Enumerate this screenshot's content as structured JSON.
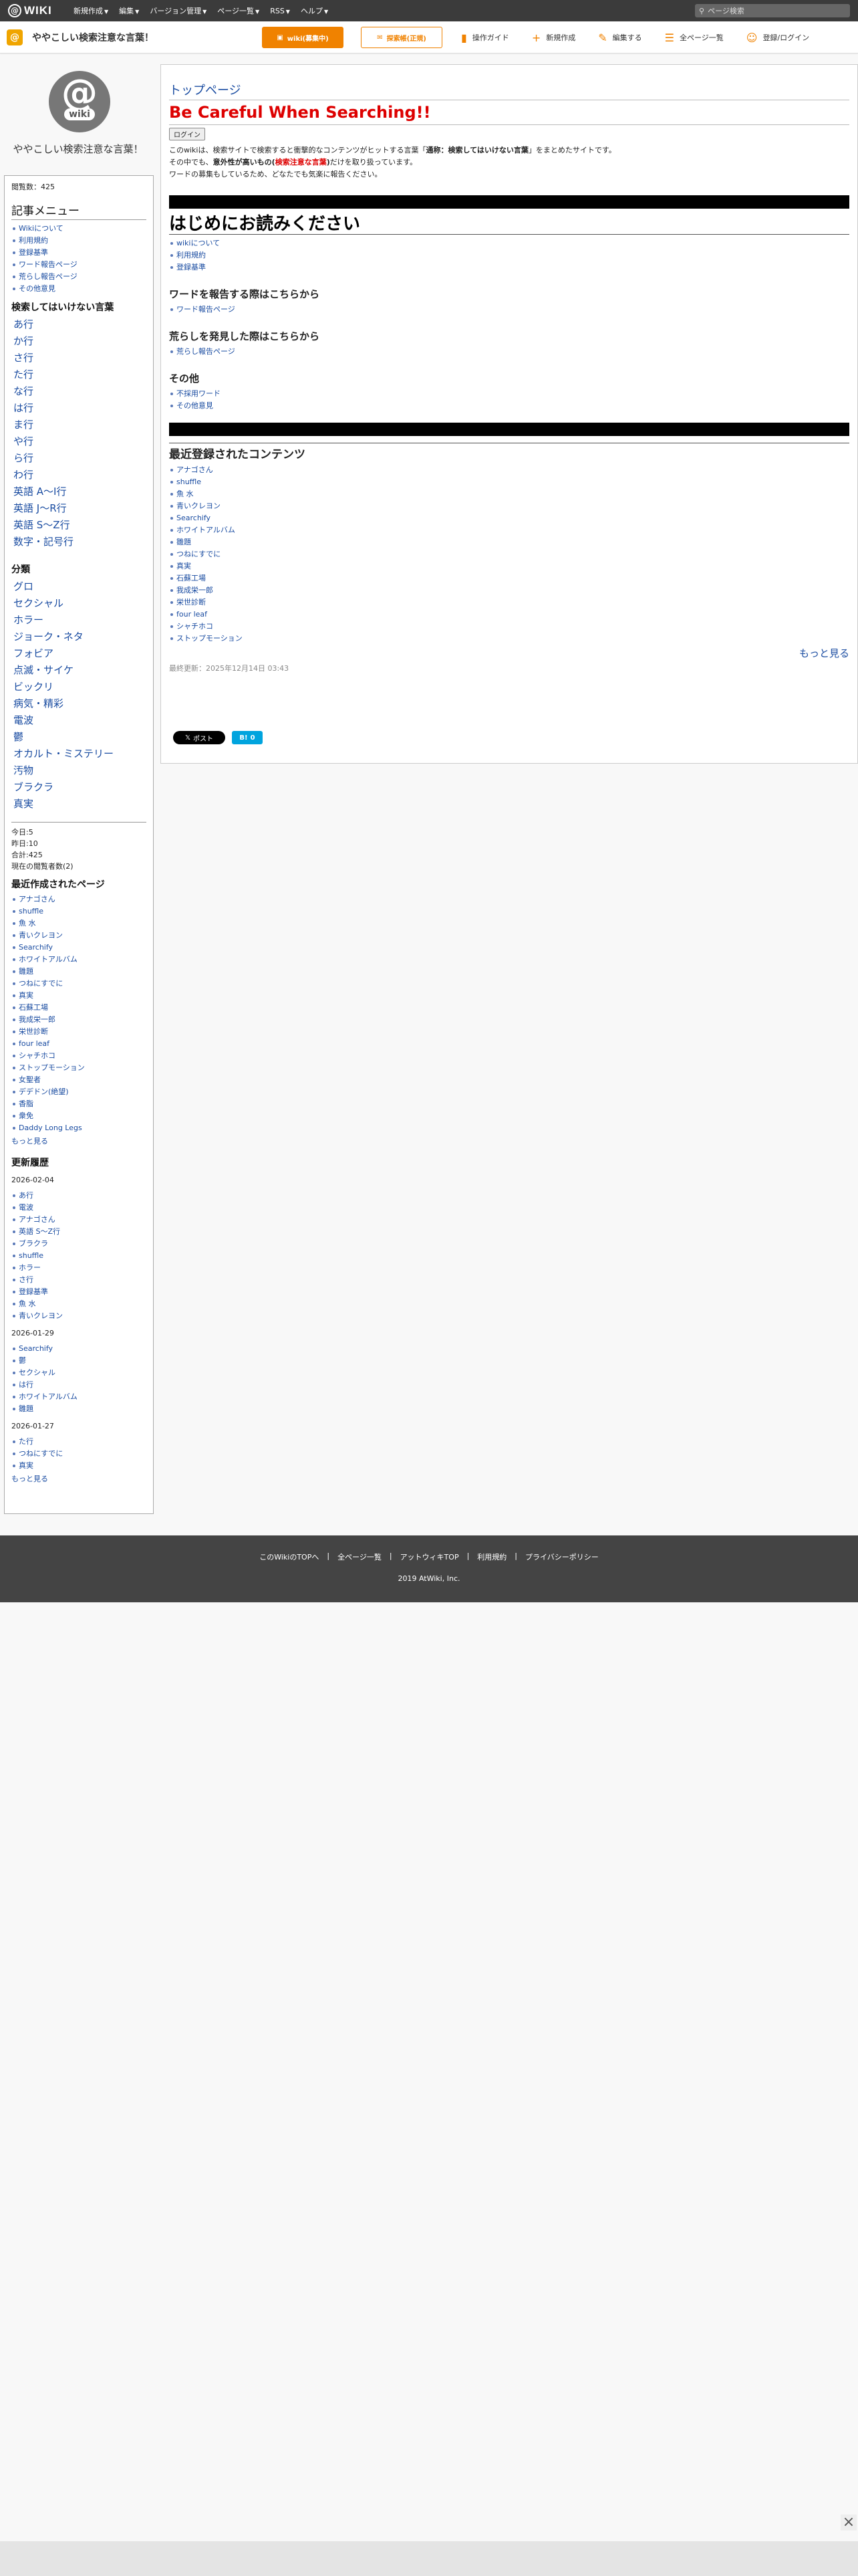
{
  "topbar": {
    "logo": "WIKI",
    "menu": [
      "新規作成",
      "編集",
      "バージョン管理",
      "ページ一覧",
      "RSS",
      "ヘルプ"
    ],
    "search_placeholder": "ページ検索"
  },
  "subbar": {
    "site": "ややこしい検索注意な言葉！",
    "wiki_btn": "wiki(募集中)",
    "news_btn": "探索帳(正規)",
    "links": [
      "操作ガイド",
      "新規作成",
      "編集する",
      "全ページ一覧",
      "登録/ログイン"
    ]
  },
  "sidebar": {
    "site_name": "ややこしい検索注意な言葉！",
    "pageviews": "閲覧数：425",
    "article_menu": {
      "title": "記事メニュー",
      "items": [
        "Wikiについて",
        "利用規約",
        "登録基準",
        "ワード報告ページ",
        "荒らし報告ページ",
        "その他意見"
      ]
    },
    "dont_search": {
      "title": "検索してはいけない言葉",
      "items": [
        "あ行",
        "か行",
        "さ行",
        "た行",
        "な行",
        "は行",
        "ま行",
        "や行",
        "ら行",
        "わ行",
        "英語 A〜I行",
        "英語 J〜R行",
        "英語 S〜Z行",
        "数字・記号行"
      ]
    },
    "categories": {
      "title": "分類",
      "items": [
        "グロ",
        "セクシャル",
        "ホラー",
        "ジョーク・ネタ",
        "フォビア",
        "点滅・サイケ",
        "ビックリ",
        "病気・精彩",
        "電波",
        "鬱",
        "オカルト・ミステリー",
        "汚物",
        "ブラクラ",
        "真実"
      ]
    },
    "counts": [
      "今日:5",
      "昨日:10",
      "合計:425",
      "現在の閲覧者数(2)"
    ],
    "recent_pages": {
      "title": "最近作成されたページ",
      "items": [
        "アナゴさん",
        "shuffle",
        "魚 水",
        "青いクレヨン",
        "Searchify",
        "ホワイトアルバム",
        "雛題",
        "つねにすでに",
        "真実",
        "石蘇工場",
        "我成栄一郎",
        "栄世診断",
        "four leaf",
        "シャチホコ",
        "ストップモーション",
        "女聖者",
        "デデドン(絶望)",
        "香脂",
        "衆免",
        "Daddy Long Legs"
      ],
      "more": "もっと見る"
    },
    "history": {
      "title": "更新履歴",
      "groups": [
        {
          "date": "2026-02-04",
          "items": [
            "あ行",
            "電波",
            "アナゴさん",
            "英語 S〜Z行",
            "ブラクラ",
            "shuffle",
            "ホラー",
            "さ行",
            "登録基準",
            "魚 水",
            "青いクレヨン"
          ]
        },
        {
          "date": "2026-01-29",
          "items": [
            "Searchify",
            "鬱",
            "セクシャル",
            "は行",
            "ホワイトアルバム",
            "雛題"
          ]
        },
        {
          "date": "2026-01-27",
          "items": [
            "た行",
            "つねにすでに",
            "真実"
          ]
        }
      ],
      "more": "もっと見る"
    }
  },
  "main": {
    "crumb": "トップページ",
    "title": "Be Careful When Searching!!",
    "login": "ログイン",
    "intro1_a": "このwikiは、検索サイトで検索すると衝撃的なコンテンツがヒットする言葉「",
    "intro1_b": "通称：検索してはいけない言葉",
    "intro1_c": "」をまとめたサイトです。",
    "intro2_a": "その中でも、",
    "intro2_b": "意外性が高いもの(",
    "intro2_c": "検索注意な言葉",
    "intro2_d": ")",
    "intro2_e": "だけを取り扱っています。",
    "intro3": "ワードの募集もしているため、どなたでも気楽に報告ください。",
    "read_first": "はじめにお読みください",
    "read_items": [
      "wikiについて",
      "利用規約",
      "登録基準"
    ],
    "report_title": "ワードを報告する際はこちらから",
    "report_items": [
      "ワード報告ページ"
    ],
    "troll_title": "荒らしを発見した際はこちらから",
    "troll_items": [
      "荒らし報告ページ"
    ],
    "other_title": "その他",
    "other_items": [
      "不採用ワード",
      "その他意見"
    ],
    "recent_title": "最近登録されたコンテンツ",
    "recent_items": [
      "アナゴさん",
      "shuffle",
      "魚 水",
      "青いクレヨン",
      "Searchify",
      "ホワイトアルバム",
      "雛題",
      "つねにすでに",
      "真実",
      "石蘇工場",
      "我成栄一郎",
      "栄世診断",
      "four leaf",
      "シャチホコ",
      "ストップモーション"
    ],
    "more": "もっと見る",
    "updated": "最終更新：2025年12月14日 03:43",
    "post_btn": "ポスト",
    "hatena_btn": "0"
  },
  "footer": {
    "links": [
      "このWikiのTOPへ",
      "全ページ一覧",
      "アットウィキTOP",
      "利用規約",
      "プライバシーポリシー"
    ],
    "copyright": "2019 AtWiki, Inc."
  }
}
